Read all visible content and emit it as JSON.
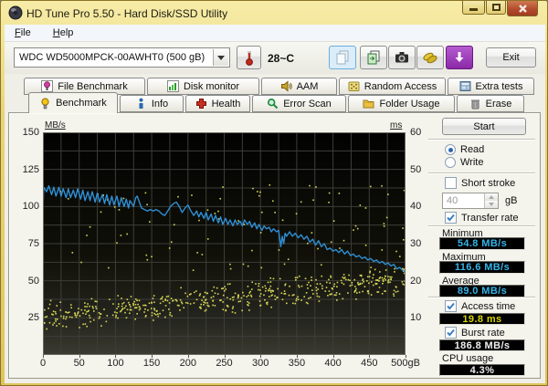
{
  "window": {
    "title": "HD Tune Pro 5.50 - Hard Disk/SSD Utility"
  },
  "menu": {
    "items": [
      "File",
      "Help"
    ]
  },
  "toolbar": {
    "drive_select": "WDC WD5000MPCK-00AWHT0 (500 gB)",
    "temperature": "28~C",
    "exit_label": "Exit"
  },
  "tabs": {
    "row1": [
      {
        "label": "File Benchmark"
      },
      {
        "label": "Disk monitor"
      },
      {
        "label": "AAM"
      },
      {
        "label": "Random Access"
      },
      {
        "label": "Extra tests"
      }
    ],
    "row2": [
      {
        "label": "Benchmark",
        "active": true
      },
      {
        "label": "Info"
      },
      {
        "label": "Health"
      },
      {
        "label": "Error Scan"
      },
      {
        "label": "Folder Usage"
      },
      {
        "label": "Erase"
      }
    ]
  },
  "panel": {
    "start_label": "Start",
    "read_label": "Read",
    "write_label": "Write",
    "short_stroke_label": "Short stroke",
    "capacity_value": "40",
    "capacity_unit": "gB",
    "transfer_rate_label": "Transfer rate",
    "minimum_label": "Minimum",
    "minimum_value": "54.8 MB/s",
    "maximum_label": "Maximum",
    "maximum_value": "116.6 MB/s",
    "average_label": "Average",
    "average_value": "89.0 MB/s",
    "access_time_label": "Access time",
    "access_time_value": "19.8 ms",
    "burst_rate_label": "Burst rate",
    "burst_rate_value": "186.8 MB/s",
    "cpu_usage_label": "CPU usage",
    "cpu_usage_value": "4.3%"
  },
  "colors": {
    "lcd_cyan": "#35b4e8",
    "lcd_yellow": "#d6d600",
    "lcd_white": "#f0f0f0",
    "transfer_line": "#2e8fd4",
    "access_dots": "#d8d855",
    "grid": "#3e3e38",
    "titlebar_gold": "#e9d476"
  },
  "chart_data": {
    "type": "line+scatter",
    "title": "HD Tune read benchmark: transfer rate line (MB/s, left axis) and access time scatter (ms, right axis) vs disk position (gB)",
    "left_axis": {
      "label": "MB/s",
      "range": [
        0,
        150
      ],
      "ticks": [
        150,
        125,
        100,
        75,
        50,
        25
      ]
    },
    "right_axis": {
      "label": "ms",
      "range": [
        0,
        60
      ],
      "ticks": [
        60,
        50,
        40,
        30,
        20,
        10
      ]
    },
    "x_axis": {
      "range": [
        0,
        500
      ],
      "ticks": [
        {
          "v": 0,
          "label": "0"
        },
        {
          "v": 50,
          "label": "50"
        },
        {
          "v": 100,
          "label": "100"
        },
        {
          "v": 150,
          "label": "150"
        },
        {
          "v": 200,
          "label": "200"
        },
        {
          "v": 250,
          "label": "250"
        },
        {
          "v": 300,
          "label": "300"
        },
        {
          "v": 350,
          "label": "350"
        },
        {
          "v": 400,
          "label": "400"
        },
        {
          "v": 450,
          "label": "450"
        },
        {
          "v": 500,
          "label": "500gB"
        }
      ]
    },
    "grid_step": {
      "x_gb": 25,
      "left_mbs": 12.5
    },
    "series": [
      {
        "name": "transfer_rate",
        "unit": "MB/s",
        "axis": "left",
        "color": "#2e8fd4",
        "summary": {
          "minimum": 54.8,
          "maximum": 116.6,
          "average": 89.0
        },
        "points": [
          [
            0,
            96
          ],
          [
            1,
            113
          ],
          [
            5,
            110
          ],
          [
            8,
            114
          ],
          [
            12,
            108
          ],
          [
            15,
            113
          ],
          [
            18,
            107
          ],
          [
            22,
            113
          ],
          [
            25,
            107
          ],
          [
            28,
            112
          ],
          [
            32,
            106
          ],
          [
            35,
            112
          ],
          [
            38,
            106
          ],
          [
            42,
            111
          ],
          [
            45,
            106
          ],
          [
            48,
            112
          ],
          [
            52,
            105
          ],
          [
            55,
            111
          ],
          [
            58,
            104
          ],
          [
            62,
            110
          ],
          [
            65,
            104
          ],
          [
            68,
            110
          ],
          [
            72,
            103
          ],
          [
            75,
            109
          ],
          [
            78,
            103
          ],
          [
            82,
            108
          ],
          [
            85,
            102
          ],
          [
            88,
            108
          ],
          [
            92,
            101
          ],
          [
            95,
            107
          ],
          [
            98,
            101
          ],
          [
            102,
            107
          ],
          [
            105,
            100
          ],
          [
            108,
            106
          ],
          [
            112,
            100
          ],
          [
            115,
            105
          ],
          [
            118,
            99
          ],
          [
            120,
            104
          ],
          [
            125,
            100
          ],
          [
            128,
            106
          ],
          [
            130,
            107
          ],
          [
            133,
            103
          ],
          [
            136,
            99
          ],
          [
            140,
            98
          ],
          [
            144,
            97
          ],
          [
            148,
            98
          ],
          [
            152,
            97
          ],
          [
            156,
            98
          ],
          [
            160,
            97
          ],
          [
            164,
            95
          ],
          [
            168,
            94
          ],
          [
            172,
            97
          ],
          [
            176,
            100
          ],
          [
            180,
            102
          ],
          [
            184,
            103
          ],
          [
            188,
            100
          ],
          [
            192,
            96
          ],
          [
            196,
            99
          ],
          [
            200,
            101
          ],
          [
            204,
            97
          ],
          [
            208,
            94
          ],
          [
            212,
            97
          ],
          [
            215,
            93
          ],
          [
            218,
            96
          ],
          [
            222,
            92
          ],
          [
            225,
            96
          ],
          [
            228,
            91
          ],
          [
            232,
            95
          ],
          [
            235,
            90
          ],
          [
            238,
            94
          ],
          [
            242,
            89
          ],
          [
            245,
            93
          ],
          [
            248,
            88
          ],
          [
            252,
            92
          ],
          [
            255,
            88
          ],
          [
            258,
            91
          ],
          [
            262,
            87
          ],
          [
            265,
            91
          ],
          [
            268,
            88
          ],
          [
            272,
            90
          ],
          [
            275,
            87
          ],
          [
            278,
            91
          ],
          [
            282,
            88
          ],
          [
            285,
            90
          ],
          [
            288,
            86
          ],
          [
            292,
            89
          ],
          [
            295,
            85
          ],
          [
            298,
            88
          ],
          [
            302,
            84
          ],
          [
            305,
            87
          ],
          [
            308,
            85
          ],
          [
            312,
            86
          ],
          [
            315,
            83
          ],
          [
            318,
            85
          ],
          [
            322,
            83
          ],
          [
            325,
            84
          ],
          [
            328,
            73
          ],
          [
            330,
            80
          ],
          [
            332,
            75
          ],
          [
            334,
            82
          ],
          [
            336,
            80
          ],
          [
            340,
            83
          ],
          [
            344,
            80
          ],
          [
            348,
            82
          ],
          [
            352,
            79
          ],
          [
            356,
            81
          ],
          [
            360,
            78
          ],
          [
            364,
            80
          ],
          [
            368,
            76
          ],
          [
            372,
            78
          ],
          [
            376,
            74
          ],
          [
            380,
            77
          ],
          [
            384,
            73
          ],
          [
            388,
            75
          ],
          [
            392,
            71
          ],
          [
            396,
            72
          ],
          [
            400,
            70
          ],
          [
            404,
            71
          ],
          [
            408,
            69
          ],
          [
            412,
            71
          ],
          [
            416,
            68
          ],
          [
            420,
            70
          ],
          [
            424,
            67
          ],
          [
            428,
            68
          ],
          [
            432,
            66
          ],
          [
            436,
            67
          ],
          [
            440,
            65
          ],
          [
            444,
            66
          ],
          [
            448,
            64
          ],
          [
            452,
            65
          ],
          [
            456,
            63
          ],
          [
            460,
            64
          ],
          [
            464,
            62
          ],
          [
            468,
            63
          ],
          [
            472,
            61
          ],
          [
            476,
            62
          ],
          [
            480,
            60
          ],
          [
            484,
            61
          ],
          [
            488,
            58
          ],
          [
            492,
            59
          ],
          [
            496,
            57
          ],
          [
            500,
            56
          ]
        ]
      },
      {
        "name": "access_time",
        "unit": "ms",
        "axis": "right",
        "color": "#d8d855",
        "summary": {
          "average": 19.8
        },
        "scatter_spec": {
          "seed": 20130522,
          "band": {
            "count": 520,
            "ms_start": 10.5,
            "ms_end": 20.5,
            "spread": 4.5,
            "ms_min": 4
          },
          "outliers": {
            "count": 95,
            "ms_min": 23,
            "ms_max": 46,
            "x_pow": 0.65
          }
        }
      }
    ]
  }
}
